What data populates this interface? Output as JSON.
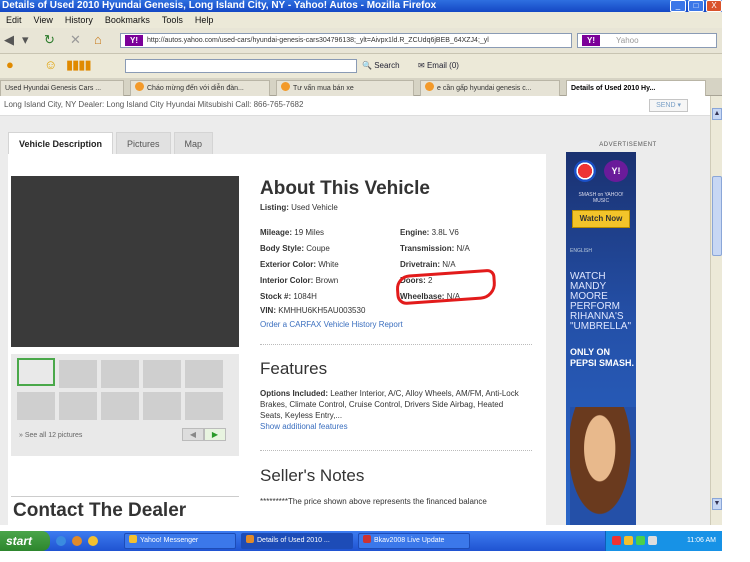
{
  "window": {
    "title": "Details of Used 2010 Hyundai Genesis, Long Island City, NY - Yahoo! Autos - Mozilla Firefox",
    "buttons": {
      "minimize": "_",
      "maximize": "□",
      "close": "X"
    }
  },
  "menu": [
    "Edit",
    "View",
    "History",
    "Bookmarks",
    "Tools",
    "Help"
  ],
  "nav": {
    "url": "http://autos.yahoo.com/used-cars/hyundai-genesis-cars304796138;_ylt=Aivpx1ld.R_ZCUdq6jBEB_64XZJ4;_yl",
    "url_badge": "Y!",
    "search_placeholder": "Yahoo",
    "search_badge": "Y!"
  },
  "toolbar": {
    "search_label": "Search",
    "email_label": "Email (0)"
  },
  "tabs": [
    {
      "label": "Used Hyundai Genesis Cars ..."
    },
    {
      "label": "Cháo mừng đến với diễn đàn..."
    },
    {
      "label": "Tư vấn mua bán xe"
    },
    {
      "label": "e cần gấp hyundai genesis c..."
    },
    {
      "label": "Details of Used 2010 Hy...",
      "active": true
    }
  ],
  "page": {
    "top_strip": "Long Island City, NY   Dealer: Long Island City Hyundai Mitsubishi   Call: 866-765-7682",
    "send_label": "SEND ▾",
    "page_tabs": [
      "Vehicle Description",
      "Pictures",
      "Map"
    ],
    "see_all": "See all 12 pictures",
    "about": {
      "title": "About This Vehicle",
      "listing_label": "Listing:",
      "listing_value": "Used Vehicle",
      "specs_left": [
        {
          "label": "Mileage:",
          "value": "19 Miles"
        },
        {
          "label": "Body Style:",
          "value": "Coupe"
        },
        {
          "label": "Exterior Color:",
          "value": "White"
        },
        {
          "label": "Interior Color:",
          "value": "Brown"
        },
        {
          "label": "Stock #:",
          "value": "1084H"
        },
        {
          "label": "VIN:",
          "value": "KMHHU6KH5AU003530"
        }
      ],
      "specs_right": [
        {
          "label": "Engine:",
          "value": "3.8L V6"
        },
        {
          "label": "Transmission:",
          "value": "N/A"
        },
        {
          "label": "Drivetrain:",
          "value": "N/A"
        },
        {
          "label": "Doors:",
          "value": "2"
        },
        {
          "label": "Wheelbase:",
          "value": "N/A"
        }
      ],
      "carfax_link": "Order a CARFAX Vehicle History Report"
    },
    "features": {
      "title": "Features",
      "options_label": "Options Included:",
      "options_text": "Leather Interior, A/C, Alloy Wheels, AM/FM, Anti-Lock Brakes, Climate Control, Cruise Control, Drivers Side Airbag, Heated Seats, Keyless Entry,...",
      "show_more": "Show additional features"
    },
    "notes": {
      "title": "Seller's Notes",
      "text": "*********The price shown above represents the financed balance"
    },
    "contact_title": "Contact The Dealer"
  },
  "ad": {
    "label": "ADVERTISEMENT",
    "logo_text": "Y!",
    "sub": "SMASH on YAHOO! MUSIC",
    "button": "Watch Now",
    "small": "ENGLISH",
    "copy": "WATCH MANDY MOORE PERFORM RIHANNA'S \"UMBRELLA\"",
    "copy2": "ONLY ON PEPSI SMASH."
  },
  "taskbar": {
    "start": "start",
    "tasks": [
      "Yahoo! Messenger",
      "Details of Used 2010 ...",
      "Bkav2008 Live Update"
    ],
    "clock": "11:06 AM"
  }
}
